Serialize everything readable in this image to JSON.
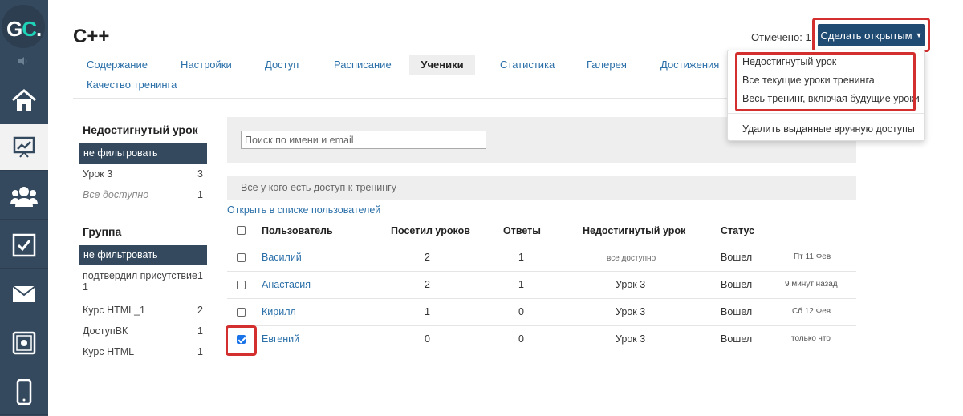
{
  "logo": {
    "part1": "G",
    "part2": "C",
    "part3": "."
  },
  "page_title": "C++",
  "marked": "Отмечено: 1",
  "open_button": {
    "label": "Сделать открытым",
    "caret": "▼"
  },
  "tabs": [
    {
      "label": "Содержание"
    },
    {
      "label": "Настройки"
    },
    {
      "label": "Доступ"
    },
    {
      "label": "Расписание"
    },
    {
      "label": "Ученики"
    },
    {
      "label": "Статистика"
    },
    {
      "label": "Галерея"
    },
    {
      "label": "Достижения"
    },
    {
      "label": "Качество тренинга"
    }
  ],
  "dropdown": {
    "items": [
      "Недостигнутый урок",
      "Все текущие уроки тренинга",
      "Весь тренинг, включая будущие уроки"
    ],
    "extra": "Удалить выданные вручную доступы"
  },
  "filters": {
    "lesson": {
      "heading": "Недостигнутый урок",
      "active": "не фильтровать",
      "rows": [
        {
          "label": "Урок 3",
          "count": "3"
        },
        {
          "label": "Все доступно",
          "count": "1"
        }
      ]
    },
    "group": {
      "heading": "Группа",
      "active": "не фильтровать",
      "rows": [
        {
          "label": "подтвердил присутствие",
          "label2": "1",
          "count": "1"
        },
        {
          "label": "Курс HTML_1",
          "count": "2"
        },
        {
          "label": "ДоступВК",
          "count": "1"
        },
        {
          "label": "Курс HTML",
          "count": "1"
        }
      ]
    }
  },
  "search": {
    "placeholder": "Поиск по имени и email"
  },
  "access_bar": "Все у кого есть доступ к тренингу",
  "open_list_link": "Открыть в списке пользователей",
  "table": {
    "headers": {
      "user": "Пользователь",
      "visited": "Посетил уроков",
      "answers": "Ответы",
      "lesson": "Недостигнутый урок",
      "status": "Статус"
    },
    "rows": [
      {
        "user": "Василий",
        "visited": "2",
        "answers": "1",
        "lesson": "все доступно",
        "status": "Вошел",
        "date": "Пт 11 Фев",
        "checked": false
      },
      {
        "user": "Анастасия",
        "visited": "2",
        "answers": "1",
        "lesson": "Урок 3",
        "status": "Вошел",
        "date": "9 минут назад",
        "checked": false
      },
      {
        "user": "Кирилл",
        "visited": "1",
        "answers": "0",
        "lesson": "Урок 3",
        "status": "Вошел",
        "date": "Сб 12 Фев",
        "checked": false
      },
      {
        "user": "Евгений",
        "visited": "0",
        "answers": "0",
        "lesson": "Урок 3",
        "status": "Вошел",
        "date": "только что",
        "checked": true
      }
    ]
  },
  "colors": {
    "sidebar": "#34495e",
    "accent": "#1f4a72",
    "link": "#2a6fa8",
    "highlight": "#d32f2f"
  }
}
